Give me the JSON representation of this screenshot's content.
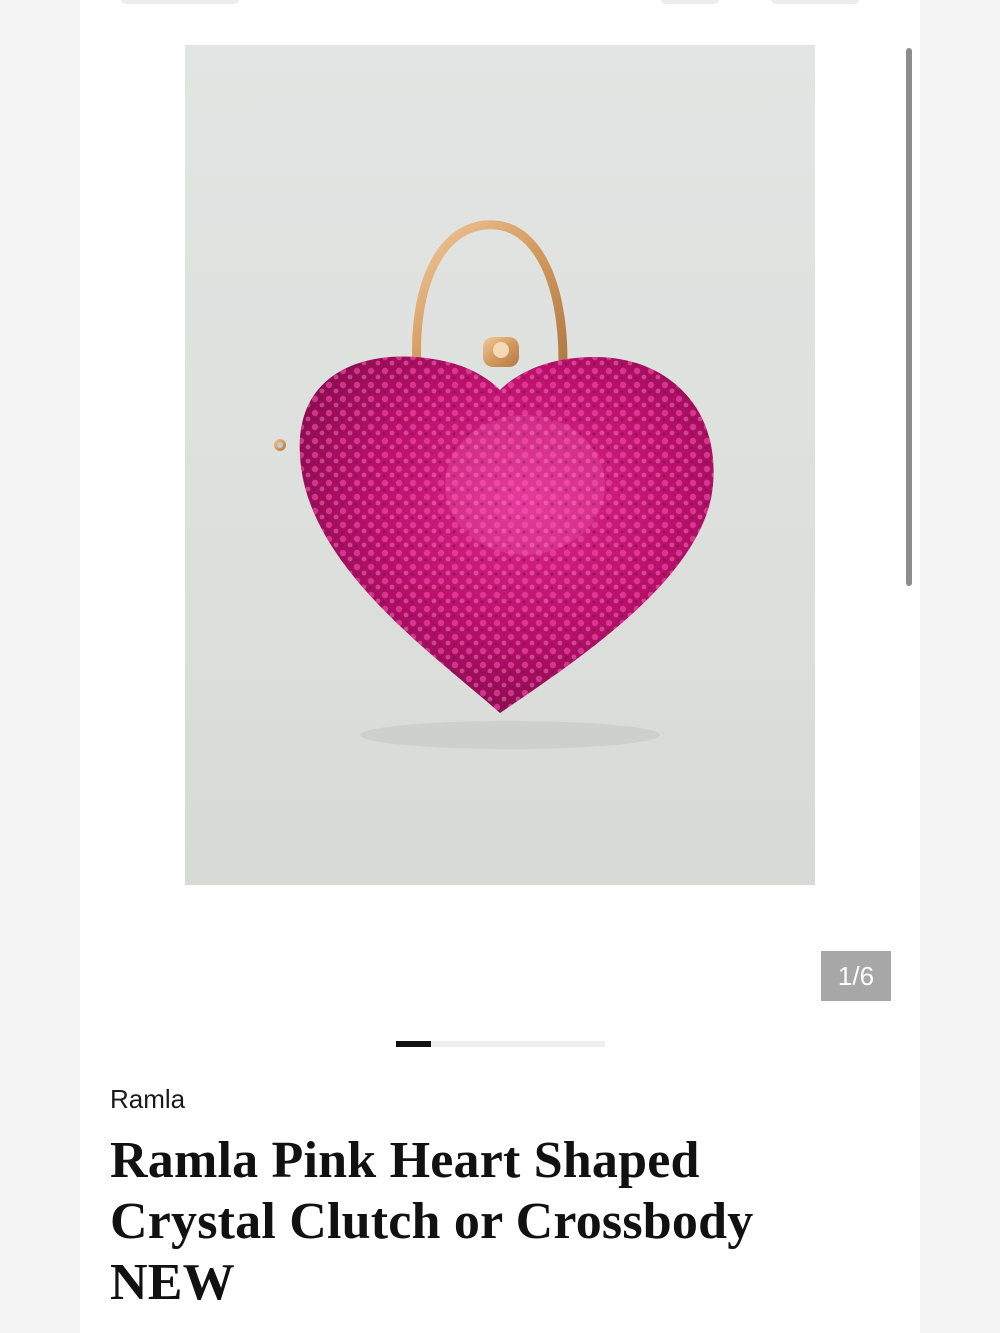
{
  "product": {
    "image_alt": "Pink crystal heart-shaped clutch bag with gold handle",
    "counter": "1/6",
    "carousel": {
      "current": 1,
      "total": 6
    },
    "brand": "Ramla",
    "title": "Ramla Pink Heart Shaped Crystal Clutch or Crossbody NEW"
  },
  "colors": {
    "crystal": "#c0166f",
    "handle": "#d9a36a",
    "counter_bg": "#a7a7a7"
  }
}
